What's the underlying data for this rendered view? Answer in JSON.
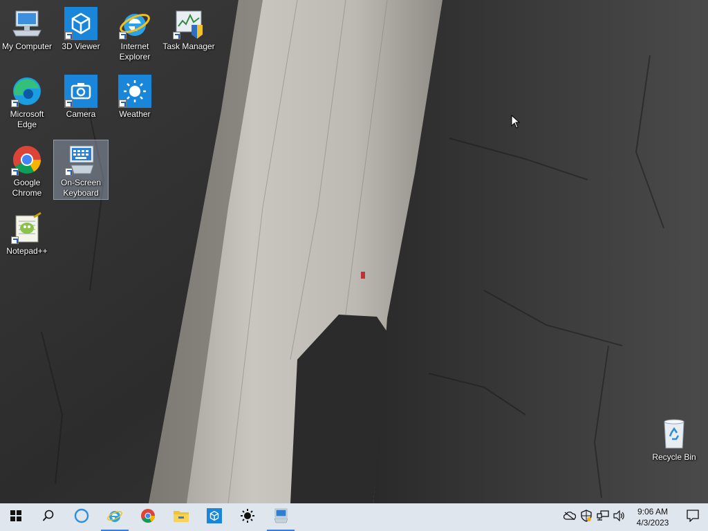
{
  "desktop": {
    "icons": [
      {
        "label": "My Computer"
      },
      {
        "label": "3D Viewer"
      },
      {
        "label": "Internet Explorer"
      },
      {
        "label": "Task Manager"
      },
      {
        "label": "Microsoft Edge"
      },
      {
        "label": "Camera"
      },
      {
        "label": "Weather"
      },
      {
        "label": "Google Chrome"
      },
      {
        "label": "On-Screen Keyboard"
      },
      {
        "label": "Notepad++"
      },
      {
        "label": "Recycle Bin"
      }
    ]
  },
  "taskbar": {
    "buttons": [
      {
        "icon": "windows-start-icon"
      },
      {
        "icon": "search-icon"
      },
      {
        "icon": "cortana-icon"
      },
      {
        "icon": "internet-explorer-icon",
        "running": true
      },
      {
        "icon": "chrome-icon"
      },
      {
        "icon": "file-explorer-icon"
      },
      {
        "icon": "3d-viewer-icon"
      },
      {
        "icon": "weather-icon"
      },
      {
        "icon": "on-screen-keyboard-icon",
        "running": true
      }
    ],
    "tray": {
      "icons": [
        "onedrive-icon",
        "security-shield-icon",
        "network-icon",
        "volume-icon"
      ],
      "time": "9:06 AM",
      "date": "4/3/2023"
    }
  },
  "colors": {
    "taskbar_bg": "#dfe6ee",
    "accent": "#3b7dd8",
    "tile_blue": "#1a86d9"
  }
}
